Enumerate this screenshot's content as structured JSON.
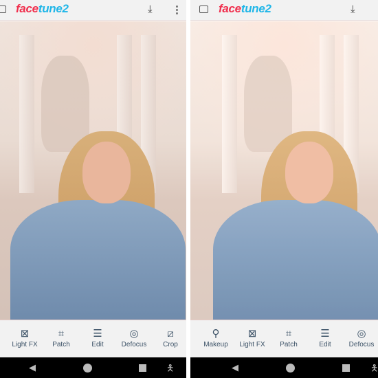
{
  "app": {
    "logo_part1": "face",
    "logo_part2": "tune2",
    "brand_colors": {
      "face": "#f0304e",
      "tune2": "#1fb6e8"
    }
  },
  "icons": {
    "gallery": "gallery-icon",
    "download": "download-icon",
    "more": "more-vertical-icon"
  },
  "left_screen": {
    "tools": [
      {
        "label": "",
        "icon": "partial-icon"
      },
      {
        "label": "Light FX",
        "icon": "light-fx-icon"
      },
      {
        "label": "Patch",
        "icon": "patch-icon"
      },
      {
        "label": "Edit",
        "icon": "sliders-icon"
      },
      {
        "label": "Defocus",
        "icon": "defocus-icon"
      },
      {
        "label": "Crop",
        "icon": "crop-icon"
      }
    ]
  },
  "right_screen": {
    "tools": [
      {
        "label": "Makeup",
        "icon": "makeup-icon"
      },
      {
        "label": "Light FX",
        "icon": "light-fx-icon"
      },
      {
        "label": "Patch",
        "icon": "patch-icon"
      },
      {
        "label": "Edit",
        "icon": "sliders-icon"
      },
      {
        "label": "Defocus",
        "icon": "defocus-icon"
      }
    ]
  }
}
